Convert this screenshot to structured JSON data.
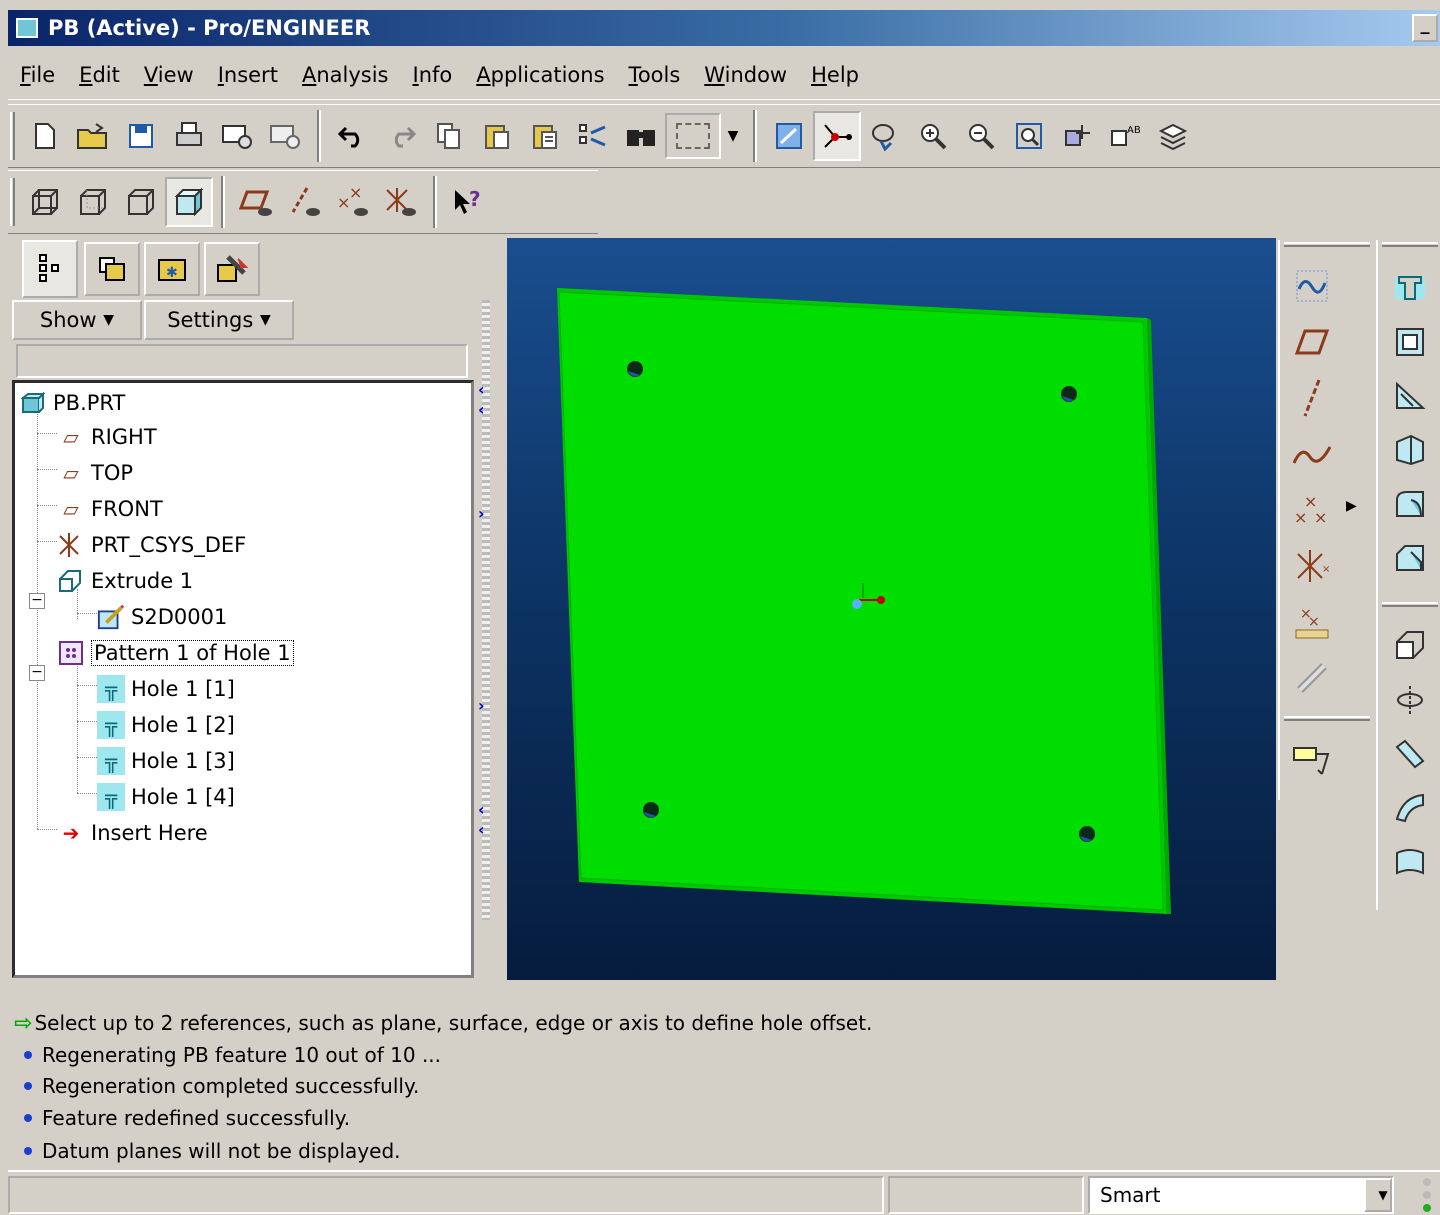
{
  "window": {
    "title": "PB (Active) - Pro/ENGINEER"
  },
  "menu": [
    "File",
    "Edit",
    "View",
    "Insert",
    "Analysis",
    "Info",
    "Applications",
    "Tools",
    "Window",
    "Help"
  ],
  "toolbar1": {
    "icons": [
      "new-file-icon",
      "open-folder-icon",
      "save-icon",
      "print-icon",
      "send-mail-icon",
      "mail-attach-icon",
      "undo-icon",
      "redo-icon",
      "copy-icon",
      "paste-icon",
      "paste-special-icon",
      "regenerate-icon",
      "search-icon",
      "selection-box-icon",
      "dropdown-arrow-icon",
      "repaint-icon",
      "spin-center-icon",
      "orient-mode-icon",
      "zoom-in-icon",
      "zoom-out-icon",
      "refit-icon",
      "reorient-icon",
      "view-manager-icon",
      "layers-icon"
    ]
  },
  "toolbar2": {
    "icons": [
      "wireframe-icon",
      "hidden-line-icon",
      "no-hidden-icon",
      "shading-icon",
      "datum-planes-toggle-icon",
      "datum-axes-toggle-icon",
      "datum-points-toggle-icon",
      "coord-systems-toggle-icon",
      "context-help-icon"
    ]
  },
  "nav_panel": {
    "tabs": [
      "model-tree-tab-icon",
      "folder-browser-tab-icon",
      "favorites-tab-icon",
      "connections-tab-icon"
    ],
    "show_label": "Show",
    "settings_label": "Settings",
    "tree": [
      {
        "label": "PB.PRT",
        "level": 0,
        "icon": "part-icon"
      },
      {
        "label": "RIGHT",
        "level": 1,
        "icon": "datum-plane-icon"
      },
      {
        "label": "TOP",
        "level": 1,
        "icon": "datum-plane-icon"
      },
      {
        "label": "FRONT",
        "level": 1,
        "icon": "datum-plane-icon"
      },
      {
        "label": "PRT_CSYS_DEF",
        "level": 1,
        "icon": "coord-system-icon"
      },
      {
        "label": "Extrude 1",
        "level": 1,
        "icon": "extrude-icon",
        "expander": "-"
      },
      {
        "label": "S2D0001",
        "level": 2,
        "icon": "sketch-icon"
      },
      {
        "label": "Pattern 1 of Hole 1",
        "level": 1,
        "icon": "pattern-icon",
        "expander": "-"
      },
      {
        "label": "Hole 1 [1]",
        "level": 2,
        "icon": "hole-icon"
      },
      {
        "label": "Hole 1 [2]",
        "level": 2,
        "icon": "hole-icon"
      },
      {
        "label": "Hole 1 [3]",
        "level": 2,
        "icon": "hole-icon"
      },
      {
        "label": "Hole 1 [4]",
        "level": 2,
        "icon": "hole-icon"
      },
      {
        "label": "Insert Here",
        "level": 1,
        "icon": "insert-here-arrow-icon"
      }
    ]
  },
  "right_toolbar1": {
    "icons": [
      "sketched-datum-curve-icon",
      "datum-plane-tool-icon",
      "datum-axis-tool-icon",
      "datum-curve-tool-icon",
      "datum-point-tool-icon",
      "coord-system-tool-icon",
      "analysis-feature-icon",
      "chain-icon",
      "annotation-icon"
    ]
  },
  "right_toolbar2": {
    "icons": [
      "hole-tool-icon",
      "shell-tool-icon",
      "rib-tool-icon",
      "draft-tool-icon",
      "round-tool-icon",
      "chamfer-tool-icon",
      "extrude-tool-icon",
      "revolve-tool-icon",
      "sweep-tool-icon",
      "blend-tool-icon",
      "boundary-blend-icon"
    ]
  },
  "messages": [
    {
      "type": "prompt",
      "text": "Select up to 2 references, such as plane, surface, edge or axis to define hole offset."
    },
    {
      "type": "info",
      "text": "Regenerating PB feature 10 out of 10 ..."
    },
    {
      "type": "info",
      "text": "Regeneration completed successfully."
    },
    {
      "type": "info",
      "text": "Feature redefined successfully."
    },
    {
      "type": "info",
      "text": "Datum planes will not be displayed."
    }
  ],
  "status": {
    "filter_value": "Smart"
  },
  "colors": {
    "part_green": "#00dd00",
    "viewport_top": "#1a4e8f",
    "viewport_bottom": "#061c3e",
    "title_bar": "#0a246a"
  }
}
